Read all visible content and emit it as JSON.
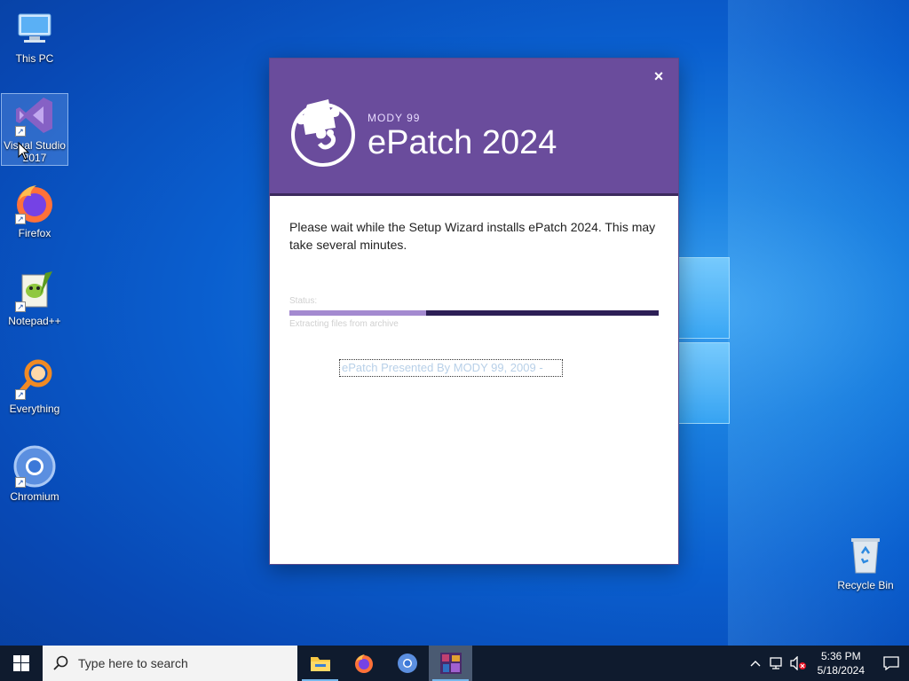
{
  "desktop": {
    "icons": [
      {
        "label": "This PC"
      },
      {
        "label": "Visual Studio 2017"
      },
      {
        "label": "Firefox"
      },
      {
        "label": "Notepad++"
      },
      {
        "label": "Everything"
      },
      {
        "label": "Chromium"
      },
      {
        "label": "Recycle Bin"
      }
    ]
  },
  "installer": {
    "brand_small": "MODY 99",
    "brand_title": "ePatch 2024",
    "close_glyph": "×",
    "message": "Please wait while the Setup Wizard installs ePatch 2024.  This may take several minutes.",
    "status_label": "Status:",
    "progress_fraction": 0.37,
    "status_text": "Extracting files from archive",
    "presented": "ePatch Presented By MODY 99, 2009 -",
    "colors": {
      "header": "#6a4c9c",
      "progress_track": "#2d1f56",
      "progress_fill": "#a48ad0"
    }
  },
  "taskbar": {
    "search_placeholder": "Type here to search",
    "apps": [
      "file-explorer",
      "firefox",
      "chromium",
      "epatch-installer"
    ],
    "time": "5:36 PM",
    "date": "5/18/2024"
  }
}
